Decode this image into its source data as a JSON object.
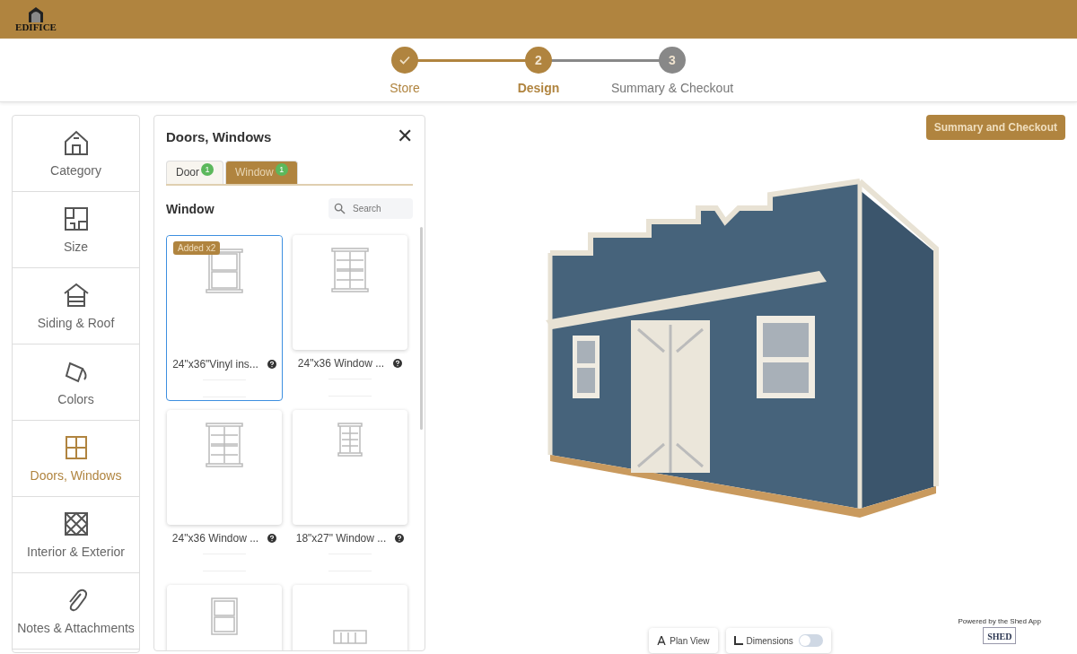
{
  "header": {
    "logo_text": "EDIFICE"
  },
  "steps": [
    {
      "label": "Store",
      "kind": "done"
    },
    {
      "number": "2",
      "label": "Design",
      "kind": "current"
    },
    {
      "number": "3",
      "label": "Summary & Checkout",
      "kind": "upcoming"
    }
  ],
  "sidebar": {
    "items": [
      {
        "label": "Category",
        "selected": false
      },
      {
        "label": "Size",
        "selected": false
      },
      {
        "label": "Siding & Roof",
        "selected": false
      },
      {
        "label": "Colors",
        "selected": false
      },
      {
        "label": "Doors, Windows",
        "selected": true
      },
      {
        "label": "Interior & Exterior",
        "selected": false
      },
      {
        "label": "Notes & Attachments",
        "selected": false
      }
    ]
  },
  "panel": {
    "title": "Doors, Windows",
    "close": "✕",
    "tabs": [
      {
        "label": "Door",
        "count": "1",
        "selected": false
      },
      {
        "label": "Window",
        "count": "1",
        "selected": true
      }
    ],
    "section_title": "Window",
    "search": {
      "placeholder": "Search"
    },
    "cards": [
      {
        "kind": "double-hung",
        "label": "24\"x36\"Vinyl ins...",
        "badge": "Added x2",
        "selected": true
      },
      {
        "kind": "grid",
        "label": "24\"x36 Window ...",
        "selected": false
      },
      {
        "kind": "grid",
        "label": "24\"x36 Window ...",
        "selected": false
      },
      {
        "kind": "small-grid",
        "label": "18\"x27\" Window ...",
        "selected": false
      },
      {
        "kind": "single",
        "selected": false
      },
      {
        "kind": "transom",
        "selected": false
      }
    ]
  },
  "viewer": {
    "checkout_button": "Summary and Checkout",
    "plan_view": "Plan View",
    "dimensions": {
      "label": "Dimensions",
      "on": false
    },
    "powered_by": "Powered by the Shed App",
    "shed_logo": "SHED"
  }
}
